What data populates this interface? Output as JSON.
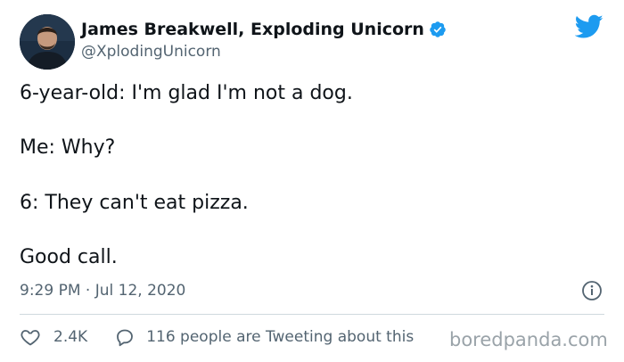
{
  "colors": {
    "twitter_blue": "#1d9bf0",
    "text_primary": "#0f1419",
    "text_secondary": "#536471",
    "divider": "#cfd9de"
  },
  "author": {
    "display_name": "James Breakwell, Exploding Unicorn",
    "handle": "@XplodingUnicorn",
    "verified_icon": "verified-badge-icon",
    "avatar_icon": "avatar"
  },
  "brand_icon": "twitter-bird-icon",
  "tweet": {
    "lines": [
      "6-year-old: I'm glad I'm not a dog.",
      "Me: Why?",
      "6: They can't eat pizza.",
      "Good call."
    ],
    "timestamp": "9:29 PM · Jul 12, 2020"
  },
  "actions": {
    "like_icon": "heart-icon",
    "like_count": "2.4K",
    "reply_icon": "speech-bubble-icon",
    "tweeting_text": "116 people are Tweeting about this"
  },
  "info_icon": "info-icon",
  "watermark": "boredpanda.com"
}
